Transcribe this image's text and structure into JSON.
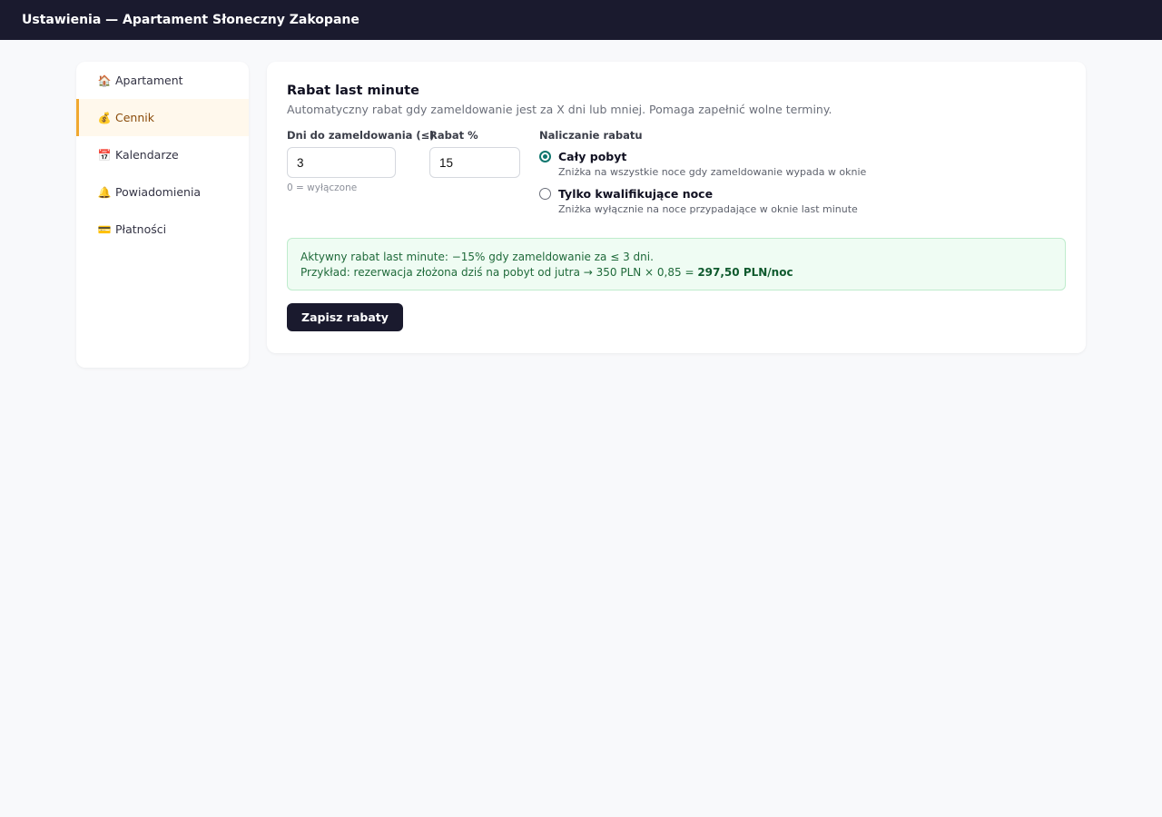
{
  "header": {
    "title": "Ustawienia — Apartament Słoneczny Zakopane"
  },
  "sidebar": {
    "items": [
      {
        "icon": "🏠",
        "icon_name": "house-icon",
        "label": "Apartament",
        "active": false
      },
      {
        "icon": "💰",
        "icon_name": "money-bag-icon",
        "label": "Cennik",
        "active": true
      },
      {
        "icon": "📅",
        "icon_name": "calendar-icon",
        "label": "Kalendarze",
        "active": false
      },
      {
        "icon": "🔔",
        "icon_name": "bell-icon",
        "label": "Powiadomienia",
        "active": false
      },
      {
        "icon": "💳",
        "icon_name": "credit-card-icon",
        "label": "Płatności",
        "active": false
      }
    ]
  },
  "card": {
    "title": "Rabat last minute",
    "subtitle": "Automatyczny rabat gdy zameldowanie jest za X dni lub mniej. Pomaga zapełnić wolne terminy."
  },
  "form": {
    "days": {
      "label": "Dni do zameldowania (≤)",
      "value": "3",
      "hint": "0 = wyłączone"
    },
    "discount": {
      "label": "Rabat %",
      "value": "15"
    },
    "mode": {
      "label": "Naliczanie rabatu",
      "options": [
        {
          "title": "Cały pobyt",
          "desc": "Zniżka na wszystkie noce gdy zameldowanie wypada w oknie",
          "checked": true
        },
        {
          "title": "Tylko kwalifikujące noce",
          "desc": "Zniżka wyłącznie na noce przypadające w oknie last minute",
          "checked": false
        }
      ]
    }
  },
  "info": {
    "line1": "Aktywny rabat last minute: −15% gdy zameldowanie za ≤ 3 dni.",
    "line2_prefix": "Przykład: rezerwacja złożona dziś na pobyt od jutra → 350 PLN × 0,85 = ",
    "line2_result": "297,50 PLN/noc"
  },
  "actions": {
    "save_label": "Zapisz rabaty"
  },
  "colors": {
    "topbar": "#1a1a2e",
    "accent": "#f0a830",
    "radio": "#0f766e",
    "info_bg": "#effcf3"
  }
}
